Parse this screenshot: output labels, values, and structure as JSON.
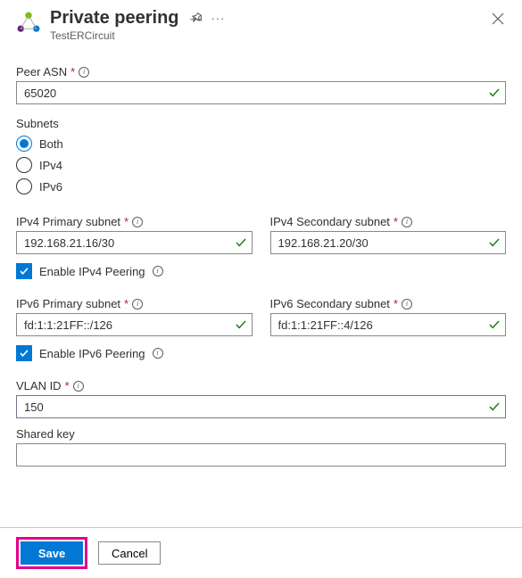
{
  "header": {
    "title": "Private peering",
    "subtitle": "TestERCircuit"
  },
  "peer_asn": {
    "label": "Peer ASN",
    "value": "65020"
  },
  "subnets": {
    "label": "Subnets",
    "selected": "both",
    "options": {
      "both": "Both",
      "v4": "IPv4",
      "v6": "IPv6"
    }
  },
  "ipv4_primary": {
    "label": "IPv4 Primary subnet",
    "value": "192.168.21.16/30"
  },
  "ipv4_secondary": {
    "label": "IPv4 Secondary subnet",
    "value": "192.168.21.20/30"
  },
  "enable_v4": {
    "label": "Enable IPv4 Peering",
    "checked": true
  },
  "ipv6_primary": {
    "label": "IPv6 Primary subnet",
    "value": "fd:1:1:21FF::/126"
  },
  "ipv6_secondary": {
    "label": "IPv6 Secondary subnet",
    "value": "fd:1:1:21FF::4/126"
  },
  "enable_v6": {
    "label": "Enable IPv6 Peering",
    "checked": true
  },
  "vlan": {
    "label": "VLAN ID",
    "value": "150"
  },
  "shared_key": {
    "label": "Shared key",
    "value": ""
  },
  "buttons": {
    "save": "Save",
    "cancel": "Cancel"
  }
}
